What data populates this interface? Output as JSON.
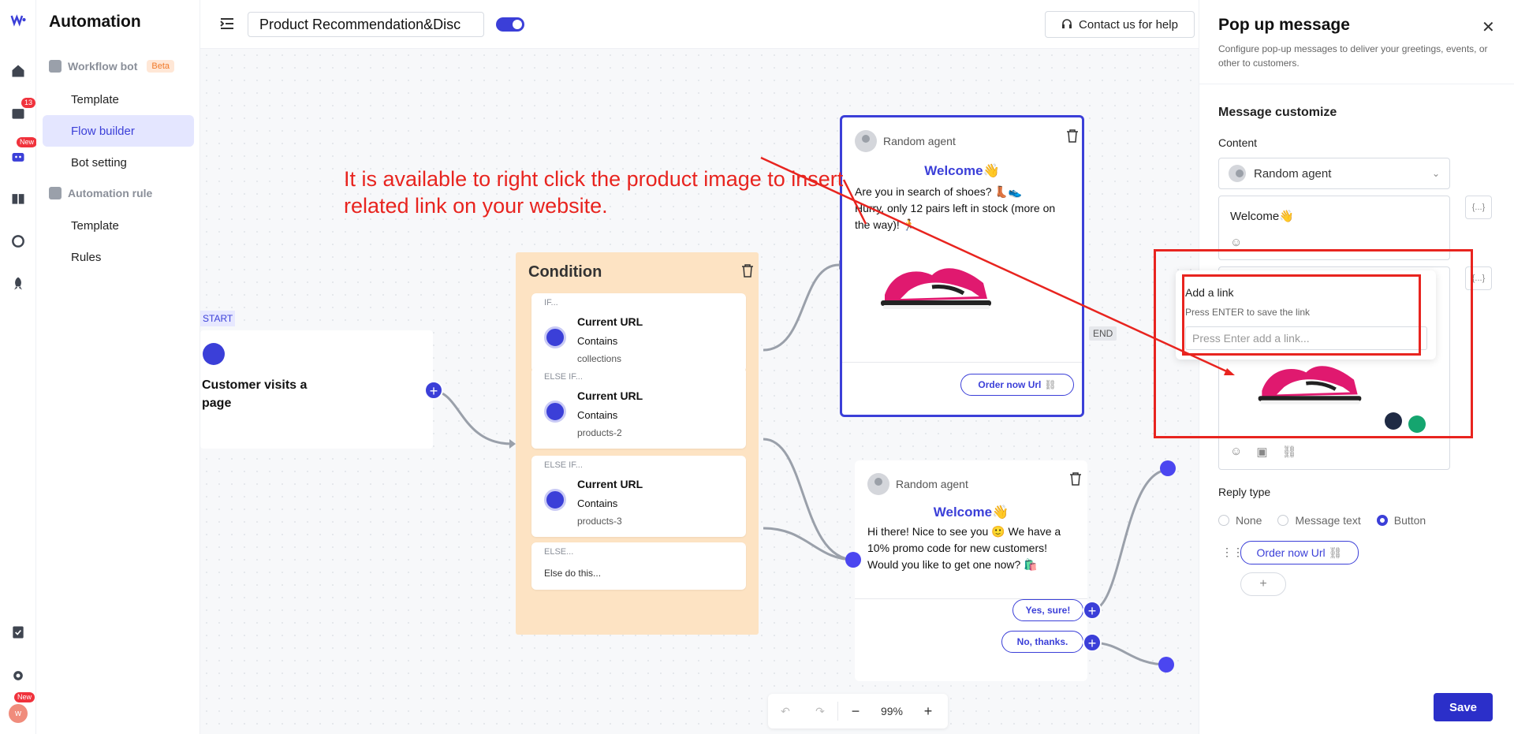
{
  "app": {
    "title": "Automation"
  },
  "rail": {
    "inbox_badge": "13",
    "chat_badge": "New",
    "avatar_badge": "New",
    "avatar_letter": "w"
  },
  "sidebar": {
    "groups": [
      {
        "label": "Workflow bot",
        "badge": "Beta",
        "items": [
          {
            "label": "Template"
          },
          {
            "label": "Flow builder",
            "active": true
          },
          {
            "label": "Bot setting"
          }
        ]
      },
      {
        "label": "Automation rule",
        "items": [
          {
            "label": "Template"
          },
          {
            "label": "Rules"
          }
        ]
      }
    ]
  },
  "topbar": {
    "flow_name": "Product Recommendation&Disc",
    "enabled": true,
    "help_label": "Contact us for help"
  },
  "canvas": {
    "start_tag": "START",
    "start_text": "Customer visits a page",
    "annotation": "It is available to right click the product image to insert related link on your website.",
    "condition": {
      "title": "Condition",
      "branches": [
        {
          "label": "IF...",
          "field": "Current URL",
          "op": "Contains",
          "value": "collections"
        },
        {
          "label": "ELSE IF...",
          "field": "Current URL",
          "op": "Contains",
          "value": "products-2"
        },
        {
          "label": "ELSE IF...",
          "field": "Current URL",
          "op": "Contains",
          "value": "products-3"
        }
      ],
      "else_label": "ELSE...",
      "else_text": "Else do this..."
    },
    "message1": {
      "agent": "Random agent",
      "welcome": "Welcome👋",
      "body_line1": "Are you in search of shoes? 👢👟",
      "body_line2": "Hurry, only 12 pairs left in stock (more on",
      "body_line3": "the way)! 🏃",
      "button": "Order now Url",
      "end_tag": "END"
    },
    "message2": {
      "agent": "Random agent",
      "welcome": "Welcome👋",
      "body_line1": "Hi there! Nice to see you 🙂 We have a",
      "body_line2": "10% promo code for new customers!",
      "body_line3": "Would you like to get one now? 🛍️",
      "buttons": [
        "Yes, sure!",
        "No, thanks."
      ]
    },
    "zoom": {
      "level": "99%"
    }
  },
  "panel": {
    "title": "Pop up message",
    "description": "Configure pop-up messages to deliver your greetings, events, or other to customers.",
    "section": "Message customize",
    "content_label": "Content",
    "agent_select": "Random agent",
    "welcome_text": "Welcome👋",
    "vars_label": "{...}",
    "reply_type_label": "Reply type",
    "reply_options": [
      "None",
      "Message text",
      "Button"
    ],
    "reply_selected": "Button",
    "button_label": "Order now Url",
    "add_label": "+",
    "save_label": "Save"
  },
  "link_popover": {
    "title": "Add a link",
    "subtitle": "Press ENTER to save the link",
    "placeholder": "Press Enter add a link..."
  },
  "colors": {
    "accent": "#3b3fd8",
    "annotation": "#e8241f",
    "condition_bg": "#fde3c3"
  }
}
